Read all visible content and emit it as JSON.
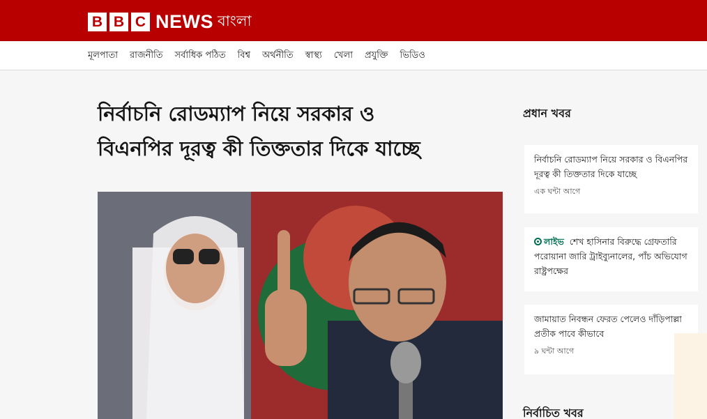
{
  "brand": {
    "box_letters": [
      "B",
      "B",
      "C"
    ],
    "news": "NEWS",
    "language": "বাংলা",
    "color": "#b80000"
  },
  "nav": {
    "items": [
      "মূলপাতা",
      "রাজনীতি",
      "সর্বাধিক পঠিত",
      "বিশ্ব",
      "অর্থনীতি",
      "স্বাস্থ্য",
      "খেলা",
      "প্রযুক্তি",
      "ভিডিও"
    ]
  },
  "article": {
    "headline_line1": "নির্বাচনি রোডম্যাপ নিয়ে সরকার ও",
    "headline_line2": "বিএনপির দূরত্ব কী তিক্ততার দিকে যাচ্ছে"
  },
  "sidebar": {
    "title": "প্রধান খবর",
    "cards": [
      {
        "title": "নির্বাচনি রোডম্যাপ নিয়ে সরকার ও বিএনপির দূরত্ব কী তিক্ততার দিকে যাচ্ছে",
        "time": "এক ঘন্টা আগে"
      },
      {
        "live_label": "লাইভ",
        "title": "শেখ হাসিনার বিরুদ্ধে গ্রেফতারি পরোয়ানা জারি ট্রাইব্যুনালের, পাঁচ অভিযোগ রাষ্ট্রপক্ষের"
      },
      {
        "title": "জামায়াত নিবন্ধন ফেরত পেলেও দাঁড়িপাল্লা প্রতীক পাবে কীভাবে",
        "time": "৯ ঘন্টা আগে"
      }
    ],
    "section2_title": "নির্বাচিত খবর"
  }
}
